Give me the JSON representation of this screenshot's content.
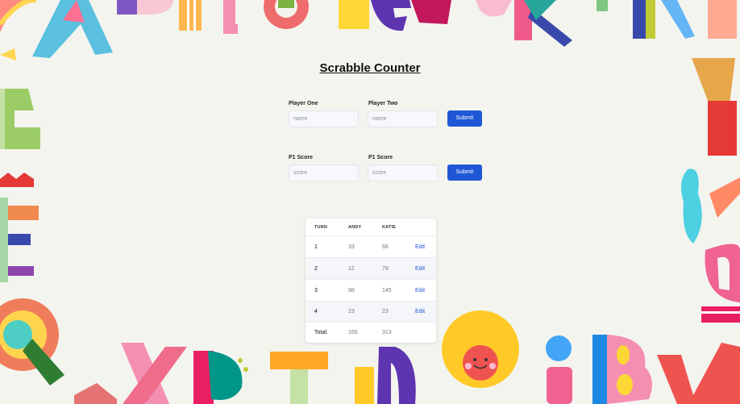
{
  "app": {
    "title": "Scrabble Counter"
  },
  "players": {
    "p1_label": "Player One",
    "p2_label": "Player Two",
    "p1_placeholder": "name",
    "p2_placeholder": "name",
    "submit_label": "Submit"
  },
  "scores": {
    "p1_label": "P1 Score",
    "p2_label": "P1 Score",
    "p1_placeholder": "score",
    "p2_placeholder": "score",
    "submit_label": "Submit"
  },
  "table": {
    "headers": {
      "turn": "TURN",
      "p1": "ANDY",
      "p2": "KATIE"
    },
    "rows": [
      {
        "turn": "1",
        "p1": "33",
        "p2": "66",
        "action": "Edit"
      },
      {
        "turn": "2",
        "p1": "12",
        "p2": "79",
        "action": "Edit"
      },
      {
        "turn": "3",
        "p1": "98",
        "p2": "145",
        "action": "Edit"
      },
      {
        "turn": "4",
        "p1": "23",
        "p2": "23",
        "action": "Edit"
      }
    ],
    "total": {
      "label": "Total:",
      "p1": "166",
      "p2": "313"
    }
  },
  "colors": {
    "accent": "#1f57d6",
    "background": "#f4f4ef"
  }
}
